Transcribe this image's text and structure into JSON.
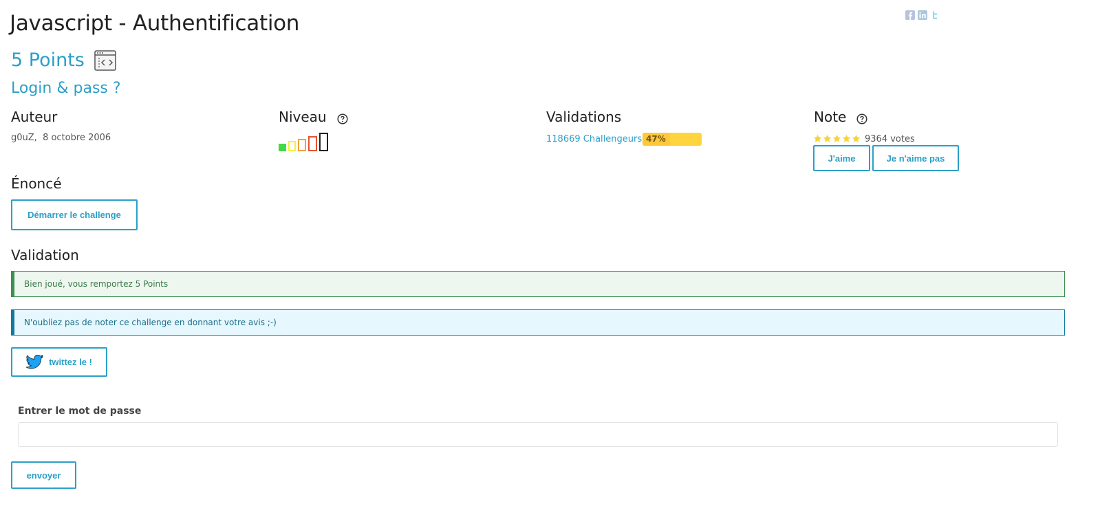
{
  "page": {
    "title": "Javascript - Authentification",
    "points": "5 Points",
    "subtitle": "Login & pass ?"
  },
  "icons": {
    "share": [
      "facebook-icon",
      "linkedin-icon",
      "twitter-icon"
    ],
    "category": "web-client-icon"
  },
  "info": {
    "author": {
      "heading": "Auteur",
      "name": "g0uZ",
      "separator": ",",
      "date": "8 octobre 2006"
    },
    "level": {
      "heading": "Niveau",
      "current_level": 1,
      "max_level": 5,
      "colors": [
        "#43d846",
        "#f2f23c",
        "#f0a33b",
        "#e2542f",
        "#222222"
      ]
    },
    "validations": {
      "heading": "Validations",
      "challengers": "118669 Challengeurs",
      "percent": 47,
      "percent_label": "47%"
    },
    "note": {
      "heading": "Note",
      "stars": 5,
      "votes": "9364 votes",
      "like_label": "J'aime",
      "dislike_label": "Je n'aime pas",
      "star_color": "#f5d33c"
    }
  },
  "statement": {
    "heading": "Énoncé",
    "start_label": "Démarrer le challenge"
  },
  "validation": {
    "heading": "Validation",
    "success_message": "Bien joué, vous remportez 5 Points",
    "info_message": "N'oubliez pas de noter ce challenge en donnant votre avis ;-)",
    "tweet_label": "twittez le !"
  },
  "password": {
    "label": "Entrer le mot de passe",
    "value": "",
    "placeholder": "",
    "submit_label": "envoyer"
  },
  "colors": {
    "accent": "#2b9fc8",
    "success": "#3e8f52",
    "info": "#14799c",
    "progress": "#ffc83a"
  }
}
